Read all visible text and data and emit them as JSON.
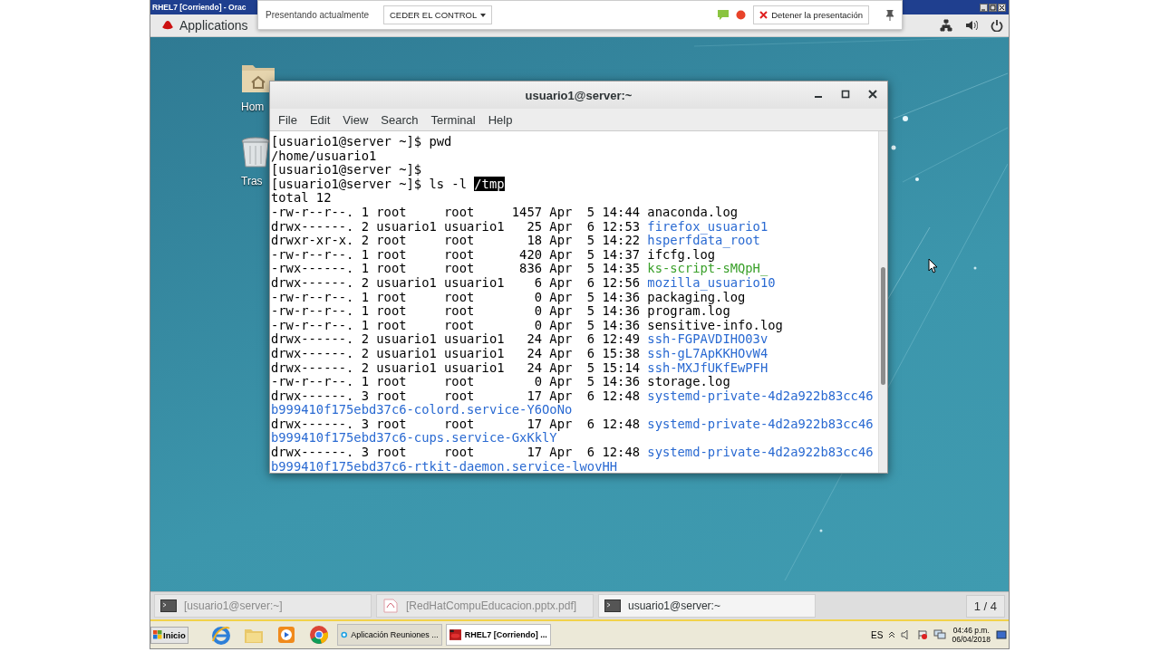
{
  "vm_window": {
    "title": "RHEL7 [Corriendo] - Orac"
  },
  "presentation_bar": {
    "status": "Presentando actualmente",
    "control_button": "CEDER EL CONTROL",
    "stop_button": "Detener la presentación"
  },
  "gnome_top_bar": {
    "menu": "Applications"
  },
  "desktop_icons": [
    {
      "label": "Hom",
      "kind": "home"
    },
    {
      "label": "Tras",
      "kind": "trash"
    }
  ],
  "terminal": {
    "title": "usuario1@server:~",
    "menu": [
      "File",
      "Edit",
      "View",
      "Search",
      "Terminal",
      "Help"
    ],
    "lines": [
      [
        {
          "text": "[usuario1@server ~]$ pwd",
          "kind": "plain"
        }
      ],
      [
        {
          "text": "/home/usuario1",
          "kind": "plain"
        }
      ],
      [
        {
          "text": "[usuario1@server ~]$",
          "kind": "plain"
        }
      ],
      [
        {
          "text": "[usuario1@server ~]$ ls -l ",
          "kind": "plain"
        },
        {
          "text": "/tmp",
          "kind": "selection"
        }
      ],
      [
        {
          "text": "total 12",
          "kind": "plain"
        }
      ],
      [
        {
          "text": "-rw-r--r--. 1 root     root     1457 Apr  5 14:44 anaconda.log",
          "kind": "plain"
        }
      ],
      [
        {
          "text": "drwx------. 2 usuario1 usuario1   25 Apr  6 12:53 ",
          "kind": "plain"
        },
        {
          "text": "firefox_usuario1",
          "kind": "dir"
        }
      ],
      [
        {
          "text": "drwxr-xr-x. 2 root     root       18 Apr  5 14:22 ",
          "kind": "plain"
        },
        {
          "text": "hsperfdata_root",
          "kind": "dir"
        }
      ],
      [
        {
          "text": "-rw-r--r--. 1 root     root      420 Apr  5 14:37 ifcfg.log",
          "kind": "plain"
        }
      ],
      [
        {
          "text": "-rwx------. 1 root     root      836 Apr  5 14:35 ",
          "kind": "plain"
        },
        {
          "text": "ks-script-sMQpH_",
          "kind": "exec"
        }
      ],
      [
        {
          "text": "drwx------. 2 usuario1 usuario1    6 Apr  6 12:56 ",
          "kind": "plain"
        },
        {
          "text": "mozilla_usuario10",
          "kind": "dir"
        }
      ],
      [
        {
          "text": "-rw-r--r--. 1 root     root        0 Apr  5 14:36 packaging.log",
          "kind": "plain"
        }
      ],
      [
        {
          "text": "-rw-r--r--. 1 root     root        0 Apr  5 14:36 program.log",
          "kind": "plain"
        }
      ],
      [
        {
          "text": "-rw-r--r--. 1 root     root        0 Apr  5 14:36 sensitive-info.log",
          "kind": "plain"
        }
      ],
      [
        {
          "text": "drwx------. 2 usuario1 usuario1   24 Apr  6 12:49 ",
          "kind": "plain"
        },
        {
          "text": "ssh-FGPAVDIHO03v",
          "kind": "dir"
        }
      ],
      [
        {
          "text": "drwx------. 2 usuario1 usuario1   24 Apr  6 15:38 ",
          "kind": "plain"
        },
        {
          "text": "ssh-gL7ApKKHOvW4",
          "kind": "dir"
        }
      ],
      [
        {
          "text": "drwx------. 2 usuario1 usuario1   24 Apr  5 15:14 ",
          "kind": "plain"
        },
        {
          "text": "ssh-MXJfUKfEwPFH",
          "kind": "dir"
        }
      ],
      [
        {
          "text": "-rw-r--r--. 1 root     root        0 Apr  5 14:36 storage.log",
          "kind": "plain"
        }
      ],
      [
        {
          "text": "drwx------. 3 root     root       17 Apr  6 12:48 ",
          "kind": "plain"
        },
        {
          "text": "systemd-private-4d2a922b83cc46",
          "kind": "dir"
        }
      ],
      [
        {
          "text": "b999410f175ebd37c6-colord.service-Y6OoNo",
          "kind": "dir"
        }
      ],
      [
        {
          "text": "drwx------. 3 root     root       17 Apr  6 12:48 ",
          "kind": "plain"
        },
        {
          "text": "systemd-private-4d2a922b83cc46",
          "kind": "dir"
        }
      ],
      [
        {
          "text": "b999410f175ebd37c6-cups.service-GxKklY",
          "kind": "dir"
        }
      ],
      [
        {
          "text": "drwx------. 3 root     root       17 Apr  6 12:48 ",
          "kind": "plain"
        },
        {
          "text": "systemd-private-4d2a922b83cc46",
          "kind": "dir"
        }
      ],
      [
        {
          "text": "b999410f175ebd37c6-rtkit-daemon.service-lwovHH",
          "kind": "dir"
        }
      ]
    ]
  },
  "window_list": {
    "items": [
      {
        "label": "[usuario1@server:~]",
        "kind": "terminal",
        "selected": false
      },
      {
        "label": "[RedHatCompuEducacion.pptx.pdf]",
        "kind": "pdf",
        "selected": false
      },
      {
        "label": "usuario1@server:~",
        "kind": "terminal",
        "selected": true
      }
    ],
    "pager": "1 / 4"
  },
  "taskbar": {
    "start": "Inicio",
    "tasks": [
      {
        "label": "Aplicación Reuniones ...",
        "kind": "chat",
        "selected": false
      },
      {
        "label": "RHEL7 [Corriendo] ...",
        "kind": "vm",
        "selected": true
      }
    ],
    "language": "ES",
    "time": "04:46 p.m.",
    "date": "06/04/2018"
  }
}
